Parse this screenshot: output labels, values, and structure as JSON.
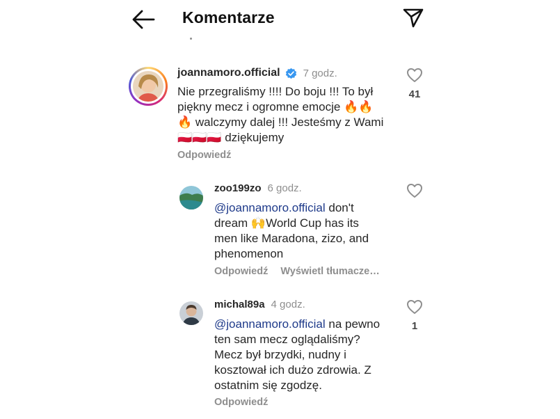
{
  "header": {
    "title": "Komentarze"
  },
  "comments": [
    {
      "username": "joannamoro.official",
      "time": "7 godz.",
      "verified": true,
      "text_lines": [
        "Nie przegraliśmy !!!! Do boju !!! To był",
        "piękny mecz i ogromne emocje 🔥🔥",
        "🔥 walczymy dalej !!! Jesteśmy z Wami",
        "🇵🇱🇵🇱🇵🇱 dziękujemy"
      ],
      "reply_label": "Odpowiedź",
      "likes": "41"
    },
    {
      "username": "zoo199zo",
      "time": "6 godz.",
      "mention": "@joannamoro.official",
      "text_first": " don't",
      "text_lines": [
        "dream 🙌World Cup has its",
        "men like Maradona, zizo, and",
        "phenomenon"
      ],
      "reply_label": "Odpowiedź",
      "translate_label": "Wyświetl tłumacze…"
    },
    {
      "username": "michal89a",
      "time": "4 godz.",
      "mention": "@joannamoro.official",
      "text_first": " na pewno",
      "text_lines": [
        "ten sam mecz oglądaliśmy?",
        "Mecz był brzydki, nudny i",
        "kosztował ich dużo zdrowia. Z",
        "ostatnim się zgodzę."
      ],
      "reply_label": "Odpowiedź",
      "likes": "1"
    }
  ],
  "icons": {
    "back": "arrow-left-icon",
    "send": "paper-plane-icon",
    "like": "heart-icon",
    "verified": "verified-badge-icon"
  },
  "colors": {
    "mention": "#1e3a8a",
    "verified": "#3897f0",
    "muted": "#8e8e8e"
  }
}
